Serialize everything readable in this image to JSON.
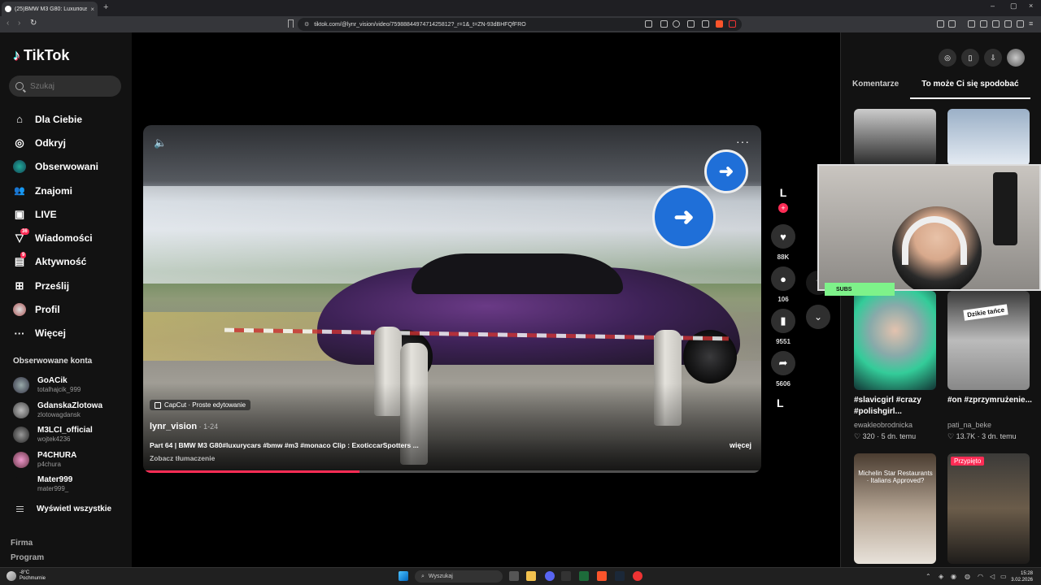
{
  "browser": {
    "tab_title": "(25)BMW M3 G80: Luxurious",
    "tab_close": "×",
    "new_tab": "+",
    "url": "tiktok.com/@lynr_vision/video/7598884497471425812?_r=1&_t=ZN-93dBHFQfFRO",
    "window_controls": [
      "–",
      "▢",
      "×"
    ]
  },
  "sidebar": {
    "logo_text": "TikTok",
    "search_placeholder": "Szukaj",
    "nav": [
      {
        "label": "Dla Ciebie",
        "icon": "home-icon",
        "glyph": "⌂",
        "badge": ""
      },
      {
        "label": "Odkryj",
        "icon": "compass-icon",
        "glyph": "◎",
        "badge": ""
      },
      {
        "label": "Obserwowani",
        "icon": "following-avatar-icon",
        "glyph": "●",
        "badge": ""
      },
      {
        "label": "Znajomi",
        "icon": "friends-icon",
        "glyph": "👥",
        "badge": ""
      },
      {
        "label": "LIVE",
        "icon": "live-tv-icon",
        "glyph": "▣",
        "badge": ""
      },
      {
        "label": "Wiadomości",
        "icon": "messages-icon",
        "glyph": "▽",
        "badge": "36"
      },
      {
        "label": "Aktywność",
        "icon": "activity-icon",
        "glyph": "▤",
        "badge": "9"
      },
      {
        "label": "Prześlij",
        "icon": "upload-icon",
        "glyph": "⊞",
        "badge": ""
      },
      {
        "label": "Profil",
        "icon": "profile-avatar-icon",
        "glyph": "●",
        "badge": ""
      },
      {
        "label": "Więcej",
        "icon": "more-icon",
        "glyph": "···",
        "badge": ""
      }
    ],
    "followed_title": "Obserwowane konta",
    "followed": [
      {
        "name": "GoACik",
        "user": "totalhajcik_999"
      },
      {
        "name": "GdanskaZlotowa",
        "user": "zlotowagdansk"
      },
      {
        "name": "M3LCI_official",
        "user": "wojtek4236"
      },
      {
        "name": "P4CHURA",
        "user": "p4chura"
      },
      {
        "name": "Mater999",
        "user": "mater999_"
      }
    ],
    "show_all": "Wyświetl wszystkie",
    "footer": [
      "Firma",
      "Program"
    ]
  },
  "video": {
    "capcut_label": "CapCut · Proste edytowanie",
    "author": "lynr_vision",
    "date": " · 1-24",
    "description": "Part 64 | BMW M3 G80#luxurycars #bmw #m3 #monaco Clip : ExoticcarSpotters ...",
    "more": "więcej",
    "translate": "Zobacz tłumaczenie",
    "progress": 0.35,
    "arrow_glyph": "➜"
  },
  "actions": {
    "likes": "88K",
    "comments": "106",
    "saves": "9551",
    "shares": "5606"
  },
  "right_panel": {
    "tabs": [
      "Komentarze",
      "To może Ci się spodobać"
    ],
    "thumbs": [
      {
        "caption": "#slavicgirl #crazy #polishgirl...",
        "user": "ewakleobrodnicka",
        "meta": "♡ 320 · 5 dn. temu"
      },
      {
        "caption": "#on #zprzymrużenie...",
        "user": "pati_na_beke",
        "meta": "♡ 13.7K · 3 dn. temu",
        "overlay": "Dzikie tańce"
      },
      {
        "caption": "",
        "user": "",
        "meta": "",
        "overlay": "Michelin Star Restaurants · Italians Approved?"
      },
      {
        "caption": "",
        "user": "",
        "meta": "",
        "pinned": "Przypięto"
      }
    ]
  },
  "overlay": {
    "subs_label": "SUBS"
  },
  "taskbar": {
    "weather_temp": "-8°C",
    "weather_desc": "Pochmurnie",
    "search": "Wyszukaj",
    "time": "15:28",
    "date": "3.02.2026"
  },
  "colors": {
    "accent": "#fe2c55",
    "bg": "#000000",
    "panel": "#121212"
  }
}
